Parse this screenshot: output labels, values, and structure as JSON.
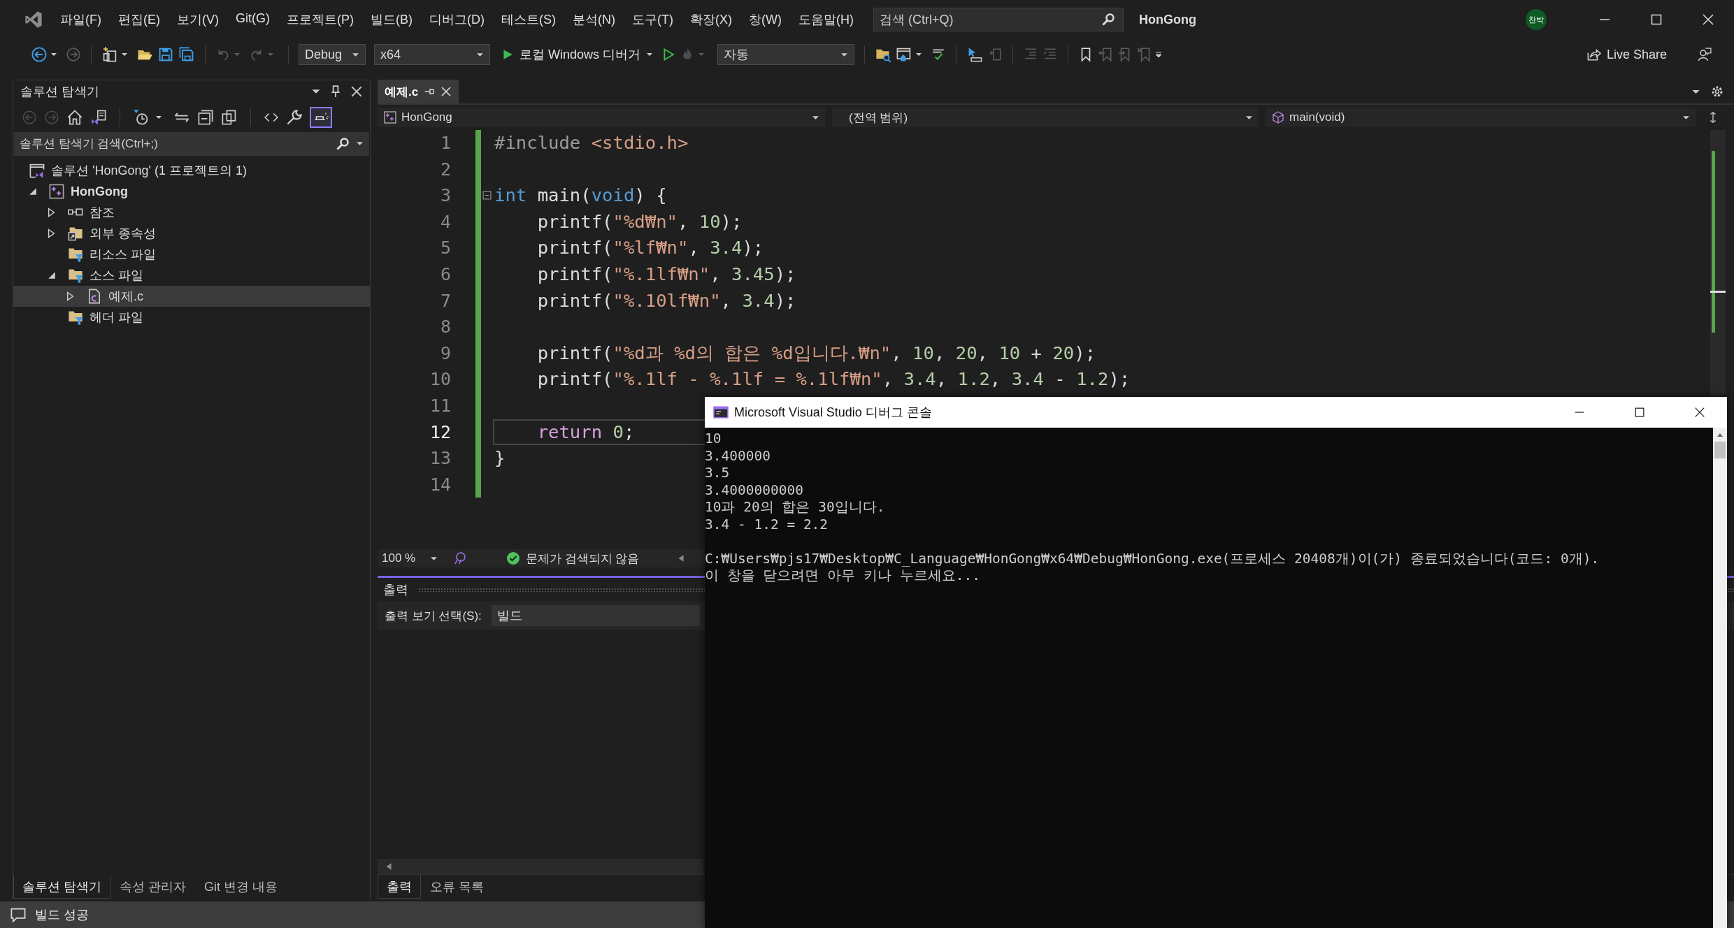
{
  "title_bar": {
    "menu": [
      "파일(F)",
      "편집(E)",
      "보기(V)",
      "Git(G)",
      "프로젝트(P)",
      "빌드(B)",
      "디버그(D)",
      "테스트(S)",
      "분석(N)",
      "도구(T)",
      "확장(X)",
      "창(W)",
      "도움말(H)"
    ],
    "search": {
      "placeholder": "검색 (Ctrl+Q)"
    },
    "title": "HonGong",
    "avatar": "찬박"
  },
  "toolbar": {
    "configuration": "Debug",
    "platform": "x64",
    "run_target": "로컬 Windows 디버거",
    "mode": "자동",
    "live_share": "Live Share"
  },
  "solution_explorer": {
    "title": "솔루션 탐색기",
    "preview_on": true,
    "search": {
      "placeholder": "솔루션 탐색기 검색(Ctrl+;)"
    },
    "tree": [
      {
        "label": "솔루션 'HonGong' (1 프로젝트의 1)",
        "kind": "solution",
        "bold": false,
        "selected": false,
        "children": [
          {
            "label": "HonGong",
            "kind": "project",
            "expanded": true,
            "bold": true,
            "selected": false,
            "children": [
              {
                "label": "참조",
                "kind": "references",
                "expanded": false,
                "bold": false,
                "selected": false
              },
              {
                "label": "외부 종속성",
                "kind": "external",
                "expanded": false,
                "bold": false,
                "selected": false
              },
              {
                "label": "리소스 파일",
                "kind": "filter",
                "bold": false,
                "selected": false
              },
              {
                "label": "소스 파일",
                "kind": "filter",
                "expanded": true,
                "bold": false,
                "selected": false,
                "children": [
                  {
                    "label": "예제.c",
                    "kind": "file",
                    "expanded": false,
                    "bold": false,
                    "selected": true
                  }
                ]
              },
              {
                "label": "헤더 파일",
                "kind": "filter",
                "bold": false,
                "selected": false
              }
            ]
          }
        ]
      }
    ],
    "tabs": [
      {
        "label": "솔루션 탐색기",
        "selected": true
      },
      {
        "label": "속성 관리자",
        "selected": false
      },
      {
        "label": "Git 변경 내용",
        "selected": false
      }
    ]
  },
  "editor": {
    "tabs": [
      {
        "label": "예제.c",
        "selected": true
      }
    ],
    "nav": {
      "project": "HonGong",
      "scope": "(전역 범위)",
      "member": "main(void)"
    },
    "lines": [
      {
        "number": "1",
        "current": false,
        "tokens": [
          {
            "kind": "preproc",
            "text": "#include "
          },
          {
            "kind": "string",
            "text": "<stdio.h>"
          }
        ]
      },
      {
        "number": "2",
        "current": false
      },
      {
        "number": "3",
        "current": false,
        "foldable": true,
        "tokens": [
          {
            "kind": "keyword",
            "text": "int"
          },
          {
            "kind": "plain",
            "text": " main("
          },
          {
            "kind": "keyword",
            "text": "void"
          },
          {
            "kind": "plain",
            "text": ") {"
          }
        ]
      },
      {
        "number": "4",
        "current": false,
        "tokens": [
          {
            "kind": "plain",
            "text": "    printf("
          },
          {
            "kind": "string",
            "text": "\"%d₩n\""
          },
          {
            "kind": "plain",
            "text": ", "
          },
          {
            "kind": "number",
            "text": "10"
          },
          {
            "kind": "plain",
            "text": ");"
          }
        ]
      },
      {
        "number": "5",
        "current": false,
        "tokens": [
          {
            "kind": "plain",
            "text": "    printf("
          },
          {
            "kind": "string",
            "text": "\"%lf₩n\""
          },
          {
            "kind": "plain",
            "text": ", "
          },
          {
            "kind": "number",
            "text": "3.4"
          },
          {
            "kind": "plain",
            "text": ");"
          }
        ]
      },
      {
        "number": "6",
        "current": false,
        "tokens": [
          {
            "kind": "plain",
            "text": "    printf("
          },
          {
            "kind": "string",
            "text": "\"%.1lf₩n\""
          },
          {
            "kind": "plain",
            "text": ", "
          },
          {
            "kind": "number",
            "text": "3.45"
          },
          {
            "kind": "plain",
            "text": ");"
          }
        ]
      },
      {
        "number": "7",
        "current": false,
        "tokens": [
          {
            "kind": "plain",
            "text": "    printf("
          },
          {
            "kind": "string",
            "text": "\"%.10lf₩n\""
          },
          {
            "kind": "plain",
            "text": ", "
          },
          {
            "kind": "number",
            "text": "3.4"
          },
          {
            "kind": "plain",
            "text": ");"
          }
        ]
      },
      {
        "number": "8",
        "current": false
      },
      {
        "number": "9",
        "current": false,
        "tokens": [
          {
            "kind": "plain",
            "text": "    printf("
          },
          {
            "kind": "string",
            "text": "\"%d과 %d의 합은 %d입니다.₩n\""
          },
          {
            "kind": "plain",
            "text": ", "
          },
          {
            "kind": "number",
            "text": "10"
          },
          {
            "kind": "plain",
            "text": ", "
          },
          {
            "kind": "number",
            "text": "20"
          },
          {
            "kind": "plain",
            "text": ", "
          },
          {
            "kind": "number",
            "text": "10"
          },
          {
            "kind": "plain",
            "text": " + "
          },
          {
            "kind": "number",
            "text": "20"
          },
          {
            "kind": "plain",
            "text": ");"
          }
        ]
      },
      {
        "number": "10",
        "current": false,
        "tokens": [
          {
            "kind": "plain",
            "text": "    printf("
          },
          {
            "kind": "string",
            "text": "\"%.1lf - %.1lf = %.1lf₩n\""
          },
          {
            "kind": "plain",
            "text": ", "
          },
          {
            "kind": "number",
            "text": "3.4"
          },
          {
            "kind": "plain",
            "text": ", "
          },
          {
            "kind": "number",
            "text": "1.2"
          },
          {
            "kind": "plain",
            "text": ", "
          },
          {
            "kind": "number",
            "text": "3.4"
          },
          {
            "kind": "plain",
            "text": " - "
          },
          {
            "kind": "number",
            "text": "1.2"
          },
          {
            "kind": "plain",
            "text": ");"
          }
        ]
      },
      {
        "number": "11",
        "current": false
      },
      {
        "number": "12",
        "current": true,
        "tokens": [
          {
            "kind": "control",
            "text": "    return "
          },
          {
            "kind": "number",
            "text": "0"
          },
          {
            "kind": "plain",
            "text": ";"
          }
        ]
      },
      {
        "number": "13",
        "current": false,
        "tokens": [
          {
            "kind": "plain",
            "text": "}"
          }
        ]
      },
      {
        "number": "14",
        "current": false
      }
    ],
    "zoom": "100 %",
    "status": "문제가 검색되지 않음"
  },
  "output": {
    "title": "출력",
    "source_label": "출력 보기 선택(S):",
    "source": "빌드",
    "tabs": [
      {
        "label": "출력",
        "selected": true
      },
      {
        "label": "오류 목록",
        "selected": false
      }
    ]
  },
  "status_bar": {
    "message": "빌드 성공"
  },
  "console": {
    "title": "Microsoft Visual Studio 디버그 콘솔",
    "output_lines": [
      "10",
      "3.400000",
      "3.5",
      "3.4000000000",
      "10과 20의 합은 30입니다.",
      "3.4 - 1.2 = 2.2"
    ],
    "exit_lines": [
      "C:₩Users₩pjs17₩Desktop₩C_Language₩HonGong₩x64₩Debug₩HonGong.exe(프로세스 20408개)이(가) 종료되었습니다(코드: 0개).",
      "이 창을 닫으려면 아무 키나 누르세요..."
    ]
  }
}
